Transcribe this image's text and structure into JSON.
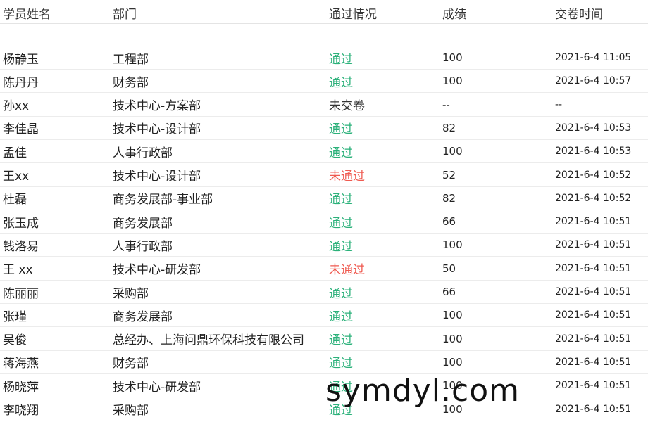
{
  "table": {
    "headers": [
      "学员姓名",
      "部门",
      "通过情况",
      "成绩",
      "交卷时间"
    ],
    "rows": [
      {
        "name": "杨静玉",
        "dept": "工程部",
        "status": "通过",
        "status_type": "pass",
        "score": "100",
        "time": "2021-6-4 11:05"
      },
      {
        "name": "陈丹丹",
        "dept": "财务部",
        "status": "通过",
        "status_type": "pass",
        "score": "100",
        "time": "2021-6-4 10:57"
      },
      {
        "name": "孙xx",
        "dept": "技术中心-方案部",
        "status": "未交卷",
        "status_type": "none",
        "score": "--",
        "time": "--"
      },
      {
        "name": "李佳晶",
        "dept": "技术中心-设计部",
        "status": "通过",
        "status_type": "pass",
        "score": "82",
        "time": "2021-6-4 10:53"
      },
      {
        "name": "孟佳",
        "dept": "人事行政部",
        "status": "通过",
        "status_type": "pass",
        "score": "100",
        "time": "2021-6-4 10:53"
      },
      {
        "name": "王xx",
        "dept": "技术中心-设计部",
        "status": "未通过",
        "status_type": "fail",
        "score": "52",
        "time": "2021-6-4 10:52"
      },
      {
        "name": "杜磊",
        "dept": "商务发展部-事业部",
        "status": "通过",
        "status_type": "pass",
        "score": "82",
        "time": "2021-6-4 10:52"
      },
      {
        "name": "张玉成",
        "dept": "商务发展部",
        "status": "通过",
        "status_type": "pass",
        "score": "66",
        "time": "2021-6-4 10:51"
      },
      {
        "name": "钱洛易",
        "dept": "人事行政部",
        "status": "通过",
        "status_type": "pass",
        "score": "100",
        "time": "2021-6-4 10:51"
      },
      {
        "name": "王 xx",
        "dept": "技术中心-研发部",
        "status": "未通过",
        "status_type": "fail",
        "score": "50",
        "time": "2021-6-4 10:51"
      },
      {
        "name": "陈丽丽",
        "dept": "采购部",
        "status": "通过",
        "status_type": "pass",
        "score": "66",
        "time": "2021-6-4 10:51"
      },
      {
        "name": "张瑾",
        "dept": "商务发展部",
        "status": "通过",
        "status_type": "pass",
        "score": "100",
        "time": "2021-6-4 10:51"
      },
      {
        "name": "吴俊",
        "dept": "总经办、上海问鼎环保科技有限公司",
        "status": "通过",
        "status_type": "pass",
        "score": "100",
        "time": "2021-6-4 10:51"
      },
      {
        "name": "蒋海燕",
        "dept": "财务部",
        "status": "通过",
        "status_type": "pass",
        "score": "100",
        "time": "2021-6-4 10:51"
      },
      {
        "name": "杨晓萍",
        "dept": "技术中心-研发部",
        "status": "通过",
        "status_type": "pass",
        "score": "100",
        "time": "2021-6-4 10:51"
      },
      {
        "name": "李晓翔",
        "dept": "采购部",
        "status": "通过",
        "status_type": "pass",
        "score": "100",
        "time": "2021-6-4 10:51"
      }
    ]
  },
  "colors": {
    "pass": "#2bb17a",
    "fail": "#ef5a50",
    "none": "#333333"
  },
  "watermark": "symdyl.com"
}
